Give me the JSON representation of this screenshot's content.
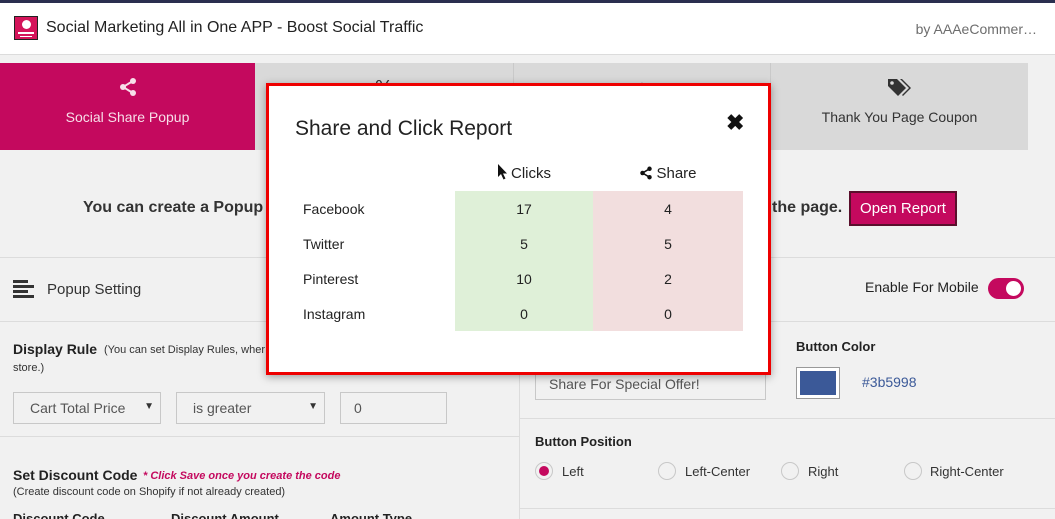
{
  "app": {
    "title": "Social Marketing All in One APP - Boost Social Traffic",
    "by": "by AAAeCommer…"
  },
  "tabs": [
    {
      "label": "Social Share Popup",
      "icon": "share-icon",
      "active": true
    },
    {
      "label": "",
      "icon": "percent-icon",
      "active": false
    },
    {
      "label": "",
      "icon": "download-icon",
      "active": false
    },
    {
      "label": "Thank You Page Coupon",
      "icon": "tags-icon",
      "active": false
    }
  ],
  "info": {
    "text_left": "You can create a Popup",
    "text_right": "the page.",
    "open_report_label": "Open Report"
  },
  "popup_setting": {
    "label": "Popup Setting",
    "enable_mobile_label": "Enable For Mobile",
    "enable_mobile_on": true
  },
  "display_rule": {
    "title": "Display Rule",
    "note": "(You can set Display Rules, wher",
    "note_cont": "store.)",
    "condition_field": "Cart Total Price",
    "operator": "is greater",
    "value": "0"
  },
  "discount": {
    "title": "Set Discount Code",
    "warning": "* Click Save once you create the code",
    "note": "(Create discount code on Shopify if not already created)",
    "col_code": "Discount Code",
    "col_amount": "Discount Amount",
    "col_type": "Amount Type"
  },
  "button_settings": {
    "text_value": "Share For Special Offer!",
    "color_label": "Button Color",
    "color_hex": "#3b5998",
    "position_label": "Button Position",
    "positions": [
      "Left",
      "Left-Center",
      "Right",
      "Right-Center"
    ],
    "selected_position": "Left"
  },
  "report_modal": {
    "title": "Share and Click Report",
    "close_icon": "close-icon",
    "col_clicks": "Clicks",
    "col_share": "Share",
    "rows": [
      {
        "network": "Facebook",
        "clicks": "17",
        "share": "4"
      },
      {
        "network": "Twitter",
        "clicks": "5",
        "share": "5"
      },
      {
        "network": "Pinterest",
        "clicks": "10",
        "share": "2"
      },
      {
        "network": "Instagram",
        "clicks": "0",
        "share": "0"
      }
    ]
  }
}
